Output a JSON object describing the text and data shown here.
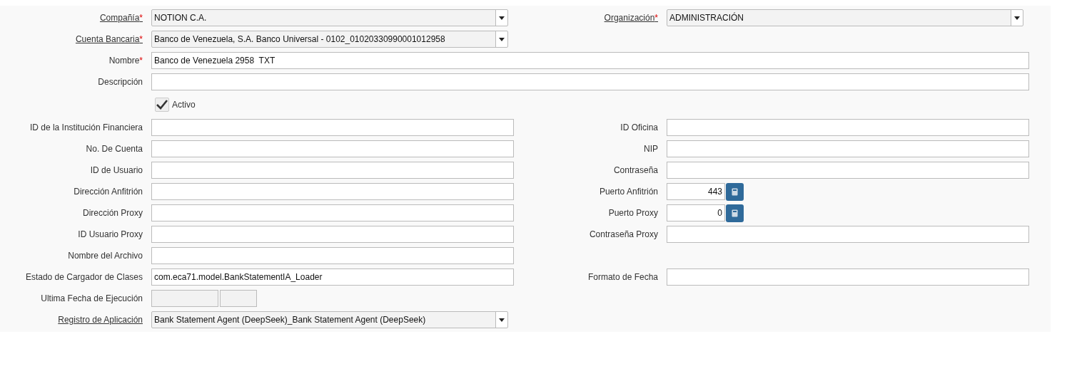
{
  "rows": [
    {
      "fields": [
        {
          "kind": "select",
          "label": "Compañía",
          "link": true,
          "mark": "*",
          "value": "NOTION C.A."
        },
        {
          "kind": "select",
          "label": "Organización",
          "link": true,
          "mark": "*",
          "value": "ADMINISTRACIÓN"
        }
      ]
    },
    {
      "fields": [
        {
          "kind": "select",
          "label": "Cuenta Bancaria",
          "link": true,
          "mark": "*",
          "value": "Banco de Venezuela, S.A. Banco Universal - 0102_01020330990001012958"
        }
      ]
    },
    {
      "fields": [
        {
          "kind": "text",
          "wide": true,
          "label": "Nombre",
          "link": false,
          "mark": "*",
          "value": "Banco de Venezuela 2958  TXT"
        }
      ]
    },
    {
      "fields": [
        {
          "kind": "text",
          "wide": true,
          "label": "Descripción",
          "link": false
        }
      ]
    },
    {
      "fields": [
        {
          "kind": "checkbox",
          "label": "Activo",
          "checked": true
        }
      ]
    },
    {
      "fields": [
        {
          "kind": "text",
          "label": "ID de la Institución Financiera",
          "link": false
        },
        {
          "kind": "text",
          "label": "ID Oficina",
          "link": false
        }
      ]
    },
    {
      "fields": [
        {
          "kind": "text",
          "label": "No. De Cuenta",
          "link": false
        },
        {
          "kind": "text",
          "label": "NIP",
          "link": false
        }
      ]
    },
    {
      "fields": [
        {
          "kind": "text",
          "label": "ID de Usuario",
          "link": false
        },
        {
          "kind": "text",
          "label": "Contraseña",
          "link": false
        }
      ]
    },
    {
      "fields": [
        {
          "kind": "text",
          "label": "Dirección Anfitrión",
          "link": false
        },
        {
          "kind": "number",
          "label": "Puerto Anfitrión",
          "link": false,
          "value": "443"
        }
      ]
    },
    {
      "fields": [
        {
          "kind": "text",
          "label": "Dirección Proxy",
          "link": false
        },
        {
          "kind": "number",
          "label": "Puerto Proxy",
          "link": false,
          "value": "0"
        }
      ]
    },
    {
      "fields": [
        {
          "kind": "text",
          "label": "ID Usuario Proxy",
          "link": false
        },
        {
          "kind": "text",
          "label": "Contraseña Proxy",
          "link": false
        }
      ]
    },
    {
      "fields": [
        {
          "kind": "text",
          "label": "Nombre del Archivo",
          "link": false
        }
      ]
    },
    {
      "fields": [
        {
          "kind": "text",
          "label": "Estado de Cargador de Clases",
          "link": false,
          "value": "com.eca71.model.BankStatementIA_Loader"
        },
        {
          "kind": "text",
          "label": "Formato de Fecha",
          "link": false
        }
      ]
    },
    {
      "fields": [
        {
          "kind": "datetime",
          "label": "Ultima Fecha de Ejecución",
          "link": false
        }
      ]
    },
    {
      "fields": [
        {
          "kind": "select",
          "label": "Registro de Aplicación",
          "link": true,
          "value": "Bank Statement Agent (DeepSeek)_Bank Statement Agent (DeepSeek)"
        }
      ]
    }
  ]
}
